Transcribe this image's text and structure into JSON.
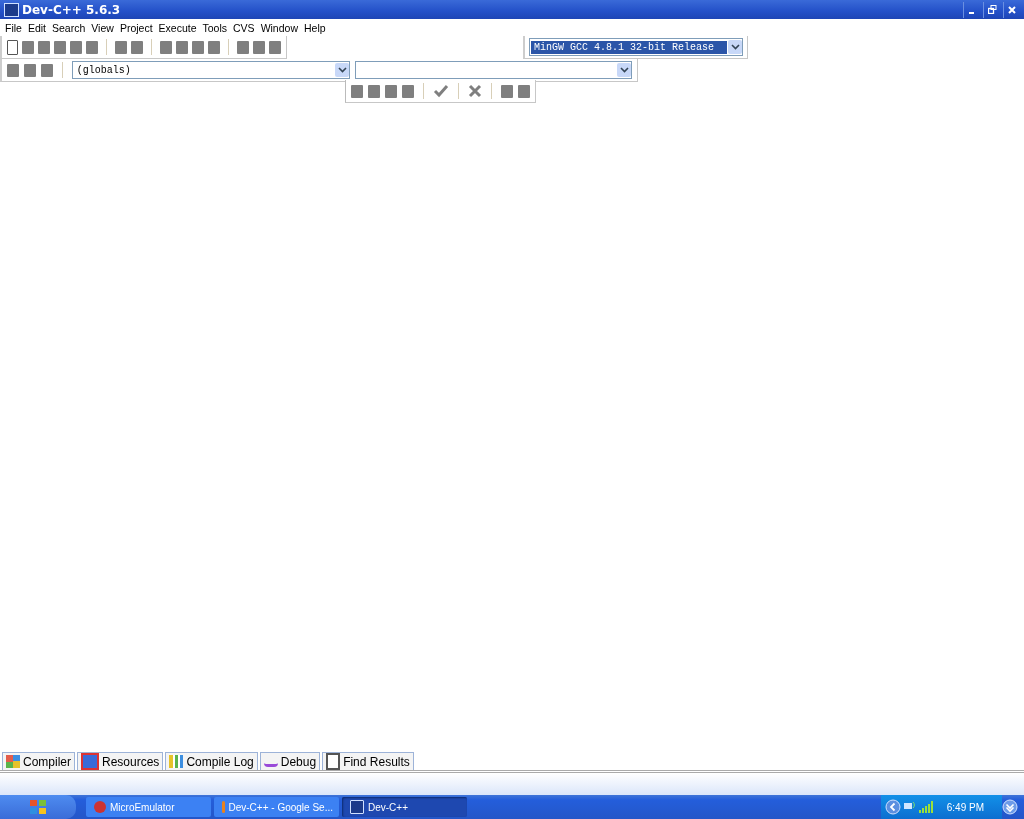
{
  "window": {
    "title": "Dev-C++ 5.6.3"
  },
  "menu": [
    "File",
    "Edit",
    "Search",
    "View",
    "Project",
    "Execute",
    "Tools",
    "CVS",
    "Window",
    "Help"
  ],
  "compiler_select": {
    "value": "MinGW GCC 4.8.1 32-bit Release"
  },
  "class_select": {
    "value": "(globals)"
  },
  "bottom_tabs": [
    {
      "label": "Compiler",
      "selected": false
    },
    {
      "label": "Resources",
      "selected": false
    },
    {
      "label": "Compile Log",
      "selected": false
    },
    {
      "label": "Debug",
      "selected": false
    },
    {
      "label": "Find Results",
      "selected": false
    }
  ],
  "taskbar": {
    "items": [
      {
        "label": "MicroEmulator",
        "selected": false
      },
      {
        "label": "Dev-C++ - Google Se...",
        "selected": false
      },
      {
        "label": "Dev-C++",
        "selected": true
      }
    ],
    "clock": "6:49 PM"
  }
}
